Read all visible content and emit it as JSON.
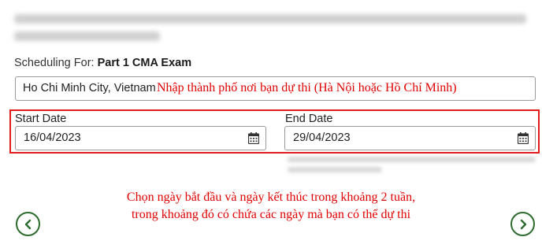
{
  "scheduling": {
    "prefix": "Scheduling For:",
    "exam": "Part 1 CMA Exam"
  },
  "location": {
    "value": "Ho Chi Minh City, Vietnam",
    "note": "Nhập thành phố nơi bạn dự thi (Hà Nội hoặc Hồ Chí Minh)"
  },
  "dates": {
    "start_label": "Start Date",
    "start_value": "16/04/2023",
    "end_label": "End Date",
    "end_value": "29/04/2023"
  },
  "instructions": {
    "line1": "Chọn ngày bắt đầu và ngày kết thúc trong khoảng 2 tuần,",
    "line2": "trong khoảng đó có chứa các ngày mà bạn có thể dự thi"
  },
  "icons": {
    "date_picker": "calendar-icon",
    "prev": "chevron-left-icon",
    "next": "chevron-right-icon"
  },
  "colors": {
    "annotation": "#e00000",
    "nav_green": "#2e6b2e",
    "highlight_border": "#e21b1b"
  }
}
